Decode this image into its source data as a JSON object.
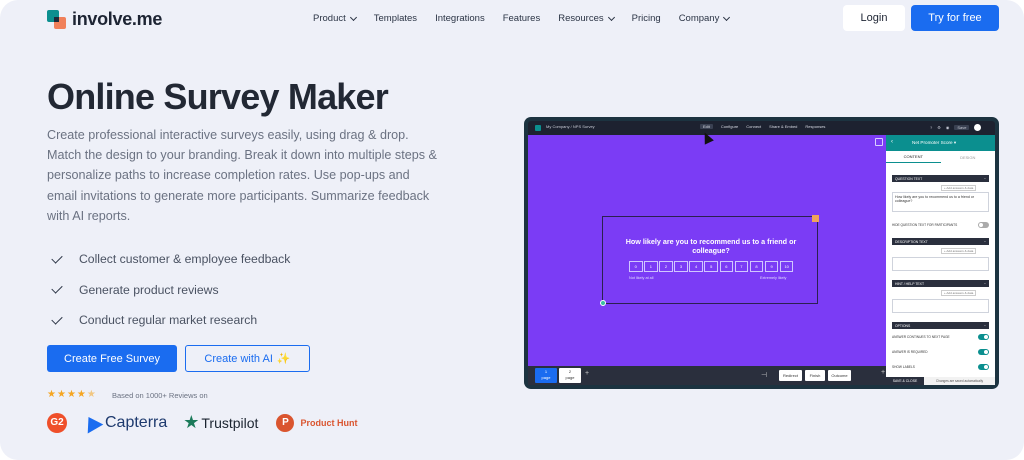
{
  "nav": {
    "logo_text": "involve.me",
    "items": [
      {
        "label": "Product",
        "dropdown": true
      },
      {
        "label": "Templates",
        "dropdown": false
      },
      {
        "label": "Integrations",
        "dropdown": false
      },
      {
        "label": "Features",
        "dropdown": false
      },
      {
        "label": "Resources",
        "dropdown": true
      },
      {
        "label": "Pricing",
        "dropdown": false
      },
      {
        "label": "Company",
        "dropdown": true
      }
    ],
    "login": "Login",
    "try_free": "Try for free"
  },
  "hero": {
    "title": "Online Survey Maker",
    "description": "Create professional interactive surveys easily, using drag & drop. Match the design to your branding. Break it down into multiple steps & personalize paths to increase completion rates. Use pop-ups and email invitations to generate more participants. Summarize feedback with AI reports.",
    "checks": [
      "Collect customer & employee feedback",
      "Generate product reviews",
      "Conduct regular market research"
    ],
    "cta_primary": "Create Free Survey",
    "cta_secondary": "Create with AI",
    "rating_stars": 4.5,
    "reviews_text": "Based on 1000+ Reviews on",
    "brands": {
      "g2": "G2",
      "capterra": "Capterra",
      "trustpilot": "Trustpilot",
      "producthunt": "Product Hunt"
    }
  },
  "app": {
    "breadcrumb": "My Company / NPS Survey",
    "tabs": [
      "Edit",
      "Configure",
      "Connect",
      "Share & Embed",
      "Responses"
    ],
    "top_right": {
      "help": "?",
      "settings": "⚙",
      "save": "Save"
    },
    "question": "How likely are you to recommend us to a friend or colleague?",
    "scale": [
      "0",
      "1",
      "2",
      "3",
      "4",
      "5",
      "6",
      "7",
      "8",
      "9",
      "10"
    ],
    "scale_low": "Not likely at all",
    "scale_high": "Extremely likely",
    "pages": [
      {
        "num": "1",
        "label": "page"
      },
      {
        "num": "2",
        "label": "page"
      }
    ],
    "bottom_buttons": [
      "Redirect",
      "Finish",
      "Outcome"
    ],
    "panel": {
      "title": "Net Promoter Score ▾",
      "tab_content": "CONTENT",
      "tab_design": "DESIGN",
      "sec_question": "QUESTION TEXT",
      "add_answers": "+ Add answers & data",
      "question_value": "How likely are you to recommend us to a friend or colleague?",
      "hide_label": "HIDE QUESTION TEXT FOR PARTICIPANTS",
      "sec_description": "DESCRIPTION TEXT",
      "sec_hint": "HINT / HELP TEXT",
      "sec_options": "OPTIONS",
      "opt1": "ANSWER CONTINUES TO NEXT PAGE",
      "opt2": "ANSWER IS REQUIRED",
      "opt3": "SHOW LABELS",
      "save_close": "SAVE & CLOSE",
      "saved_note": "Changes are saved automatically"
    }
  }
}
